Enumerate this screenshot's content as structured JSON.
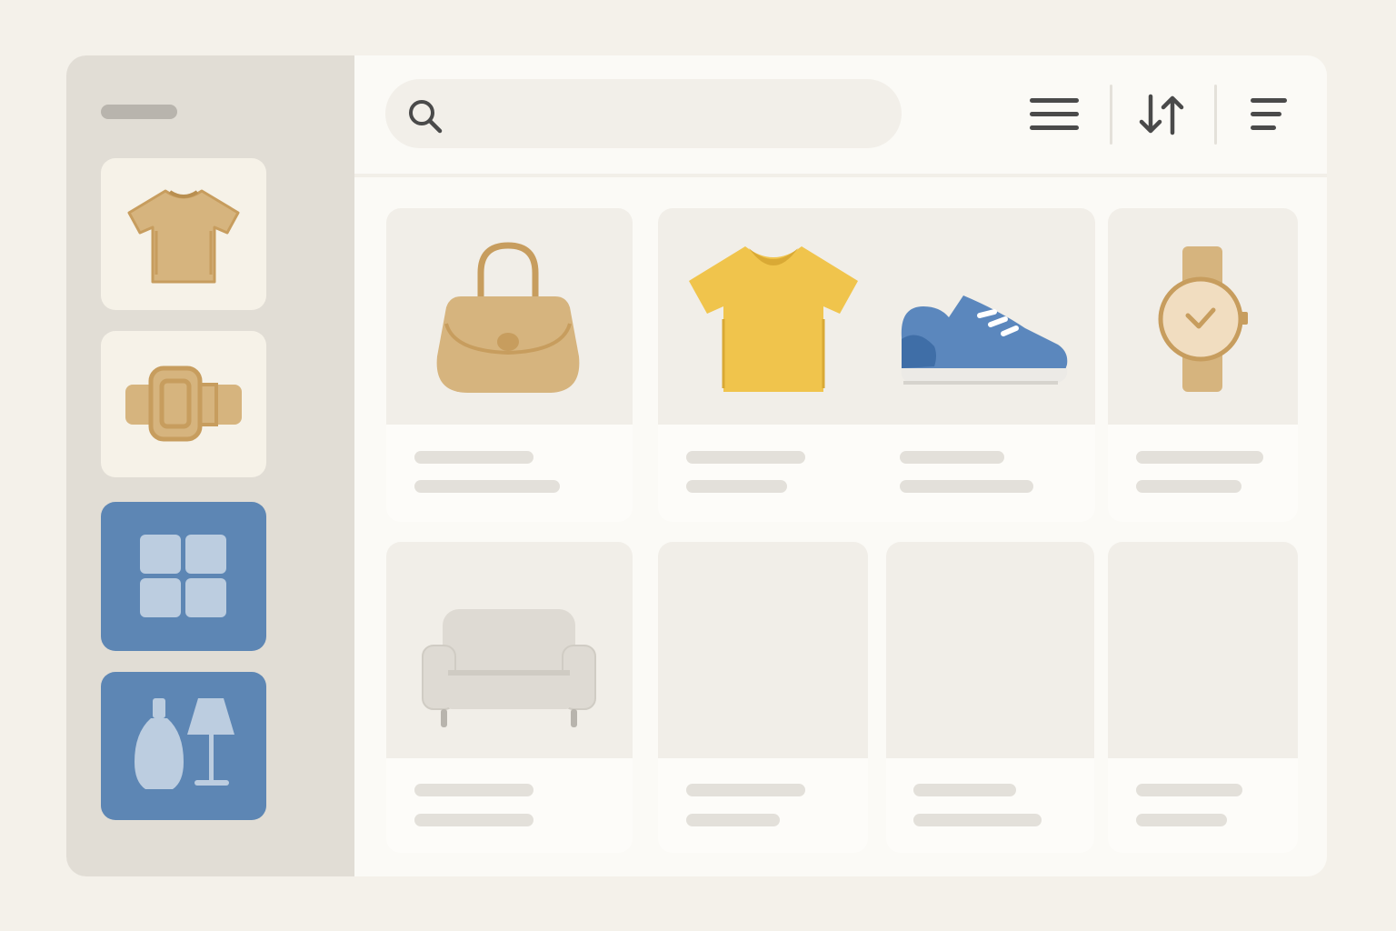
{
  "search": {
    "placeholder": "",
    "value": ""
  },
  "sidebar": {
    "categories": [
      {
        "icon": "tshirt-icon",
        "selected": false
      },
      {
        "icon": "belt-icon",
        "selected": false
      },
      {
        "icon": "grid-icon",
        "selected": true
      },
      {
        "icon": "vase-lamp-icon",
        "selected": true
      }
    ]
  },
  "toolbar": {
    "buttons": [
      {
        "icon": "menu-icon"
      },
      {
        "icon": "sort-icon"
      },
      {
        "icon": "filter-icon"
      }
    ]
  },
  "products": [
    {
      "icon": "handbag-icon"
    },
    {
      "icon": "tshirt-icon"
    },
    {
      "icon": "sneaker-icon"
    },
    {
      "icon": "watch-icon"
    },
    {
      "icon": "armchair-icon"
    },
    {
      "icon": ""
    },
    {
      "icon": ""
    },
    {
      "icon": ""
    }
  ],
  "colors": {
    "background": "#f4f1ea",
    "sidebar": "#e1ddd5",
    "accent_blue": "#5d86b4",
    "tan": "#d6b47e",
    "yellow": "#f0c44c",
    "sneaker_blue": "#5b87bd",
    "placeholder_bar": "#e3e0da"
  }
}
